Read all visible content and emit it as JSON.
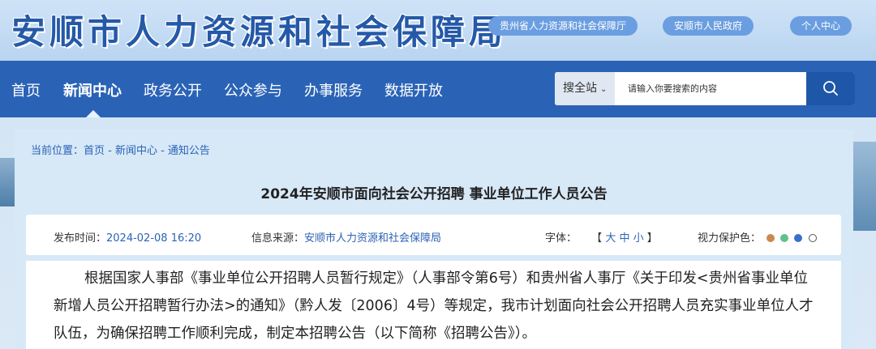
{
  "header": {
    "site_title": "安顺市人力资源和社会保障局",
    "links": [
      "贵州省人力资源和社会保障厅",
      "安顺市人民政府",
      "个人中心"
    ]
  },
  "nav": {
    "items": [
      "首页",
      "新闻中心",
      "政务公开",
      "公众参与",
      "办事服务",
      "数据开放"
    ],
    "active": "新闻中心"
  },
  "search": {
    "scope": "搜全站",
    "placeholder": "请输入你要搜索的内容",
    "button_icon": "search-icon"
  },
  "breadcrumb": {
    "text": "当前位置：首页 - 新闻中心 - 通知公告"
  },
  "article": {
    "title": "2024年安顺市面向社会公开招聘 事业单位工作人员公告",
    "publish_label": "发布时间：",
    "publish_time": "2024-02-08 16:20",
    "source_label": "信息来源：",
    "source": "安顺市人力资源和社会保障局",
    "font_label": "字体：",
    "font_sizes": [
      "大",
      "中",
      "小"
    ],
    "eye_label": "视力保护色：",
    "eye_colors": [
      "#c98a4b",
      "#5cc38a",
      "#3a6fd0",
      "#ffffff"
    ],
    "body": "根据国家人事部《事业单位公开招聘人员暂行规定》（人事部令第6号）和贵州省人事厅《关于印发<贵州省事业单位新增人员公开招聘暂行办法>的通知》（黔人发〔2006〕4号）等规定，我市计划面向社会公开招聘人员充实事业单位人才队伍，为确保招聘工作顺利完成，制定本招聘公告（以下简称《招聘公告》）。"
  }
}
